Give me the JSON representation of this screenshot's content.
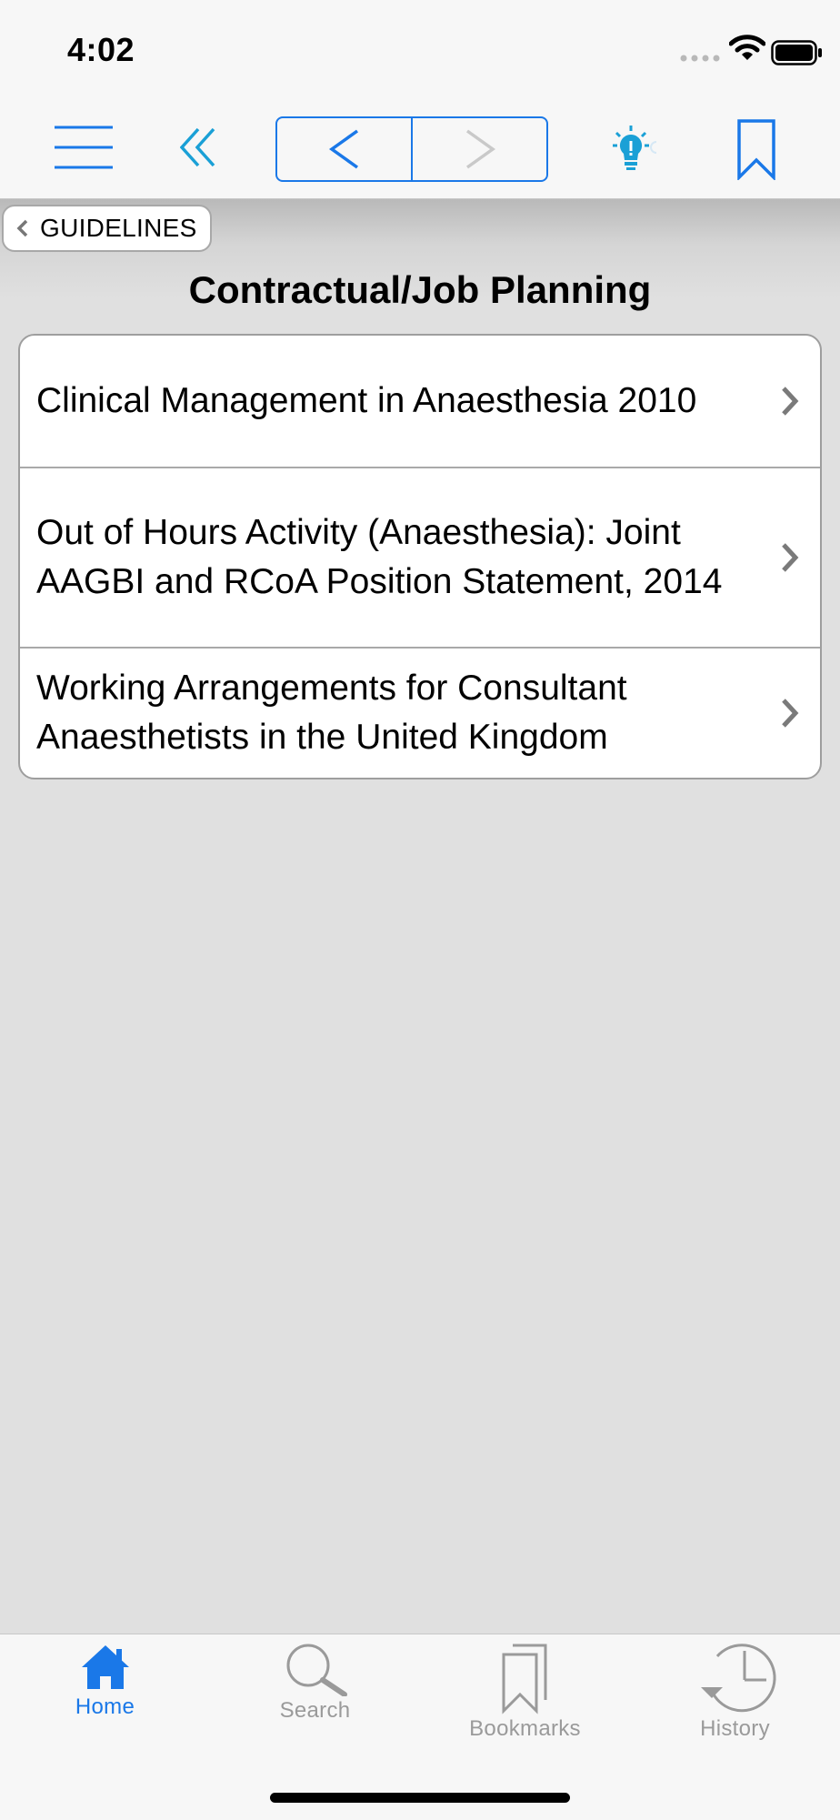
{
  "status_bar": {
    "time": "4:02"
  },
  "toolbar": {
    "icons": [
      "menu-icon",
      "double-chevron-left-icon",
      "back-arrow-icon",
      "forward-arrow-icon",
      "lightbulb-tip-icon",
      "bookmark-icon"
    ],
    "accent_color": "#1a78e8",
    "tip_color": "#1aa0d6"
  },
  "breadcrumb": {
    "label": "GUIDELINES"
  },
  "page": {
    "title": "Contractual/Job Planning"
  },
  "items": [
    {
      "label": "Clinical Management in Anaesthesia 2010"
    },
    {
      "label": "Out of Hours Activity (Anaesthesia): Joint AAGBI and RCoA Position Statement, 2014"
    },
    {
      "label": "Working Arrangements for Consultant Anaesthetists in the United Kingdom"
    }
  ],
  "tabs": [
    {
      "label": "Home",
      "icon": "home-icon",
      "active": true
    },
    {
      "label": "Search",
      "icon": "search-icon",
      "active": false
    },
    {
      "label": "Bookmarks",
      "icon": "bookmarks-icon",
      "active": false
    },
    {
      "label": "History",
      "icon": "history-icon",
      "active": false
    }
  ],
  "colors": {
    "active_tab": "#1a78e8",
    "inactive_tab": "#9a9a9a",
    "background": "#e0e0e0"
  }
}
